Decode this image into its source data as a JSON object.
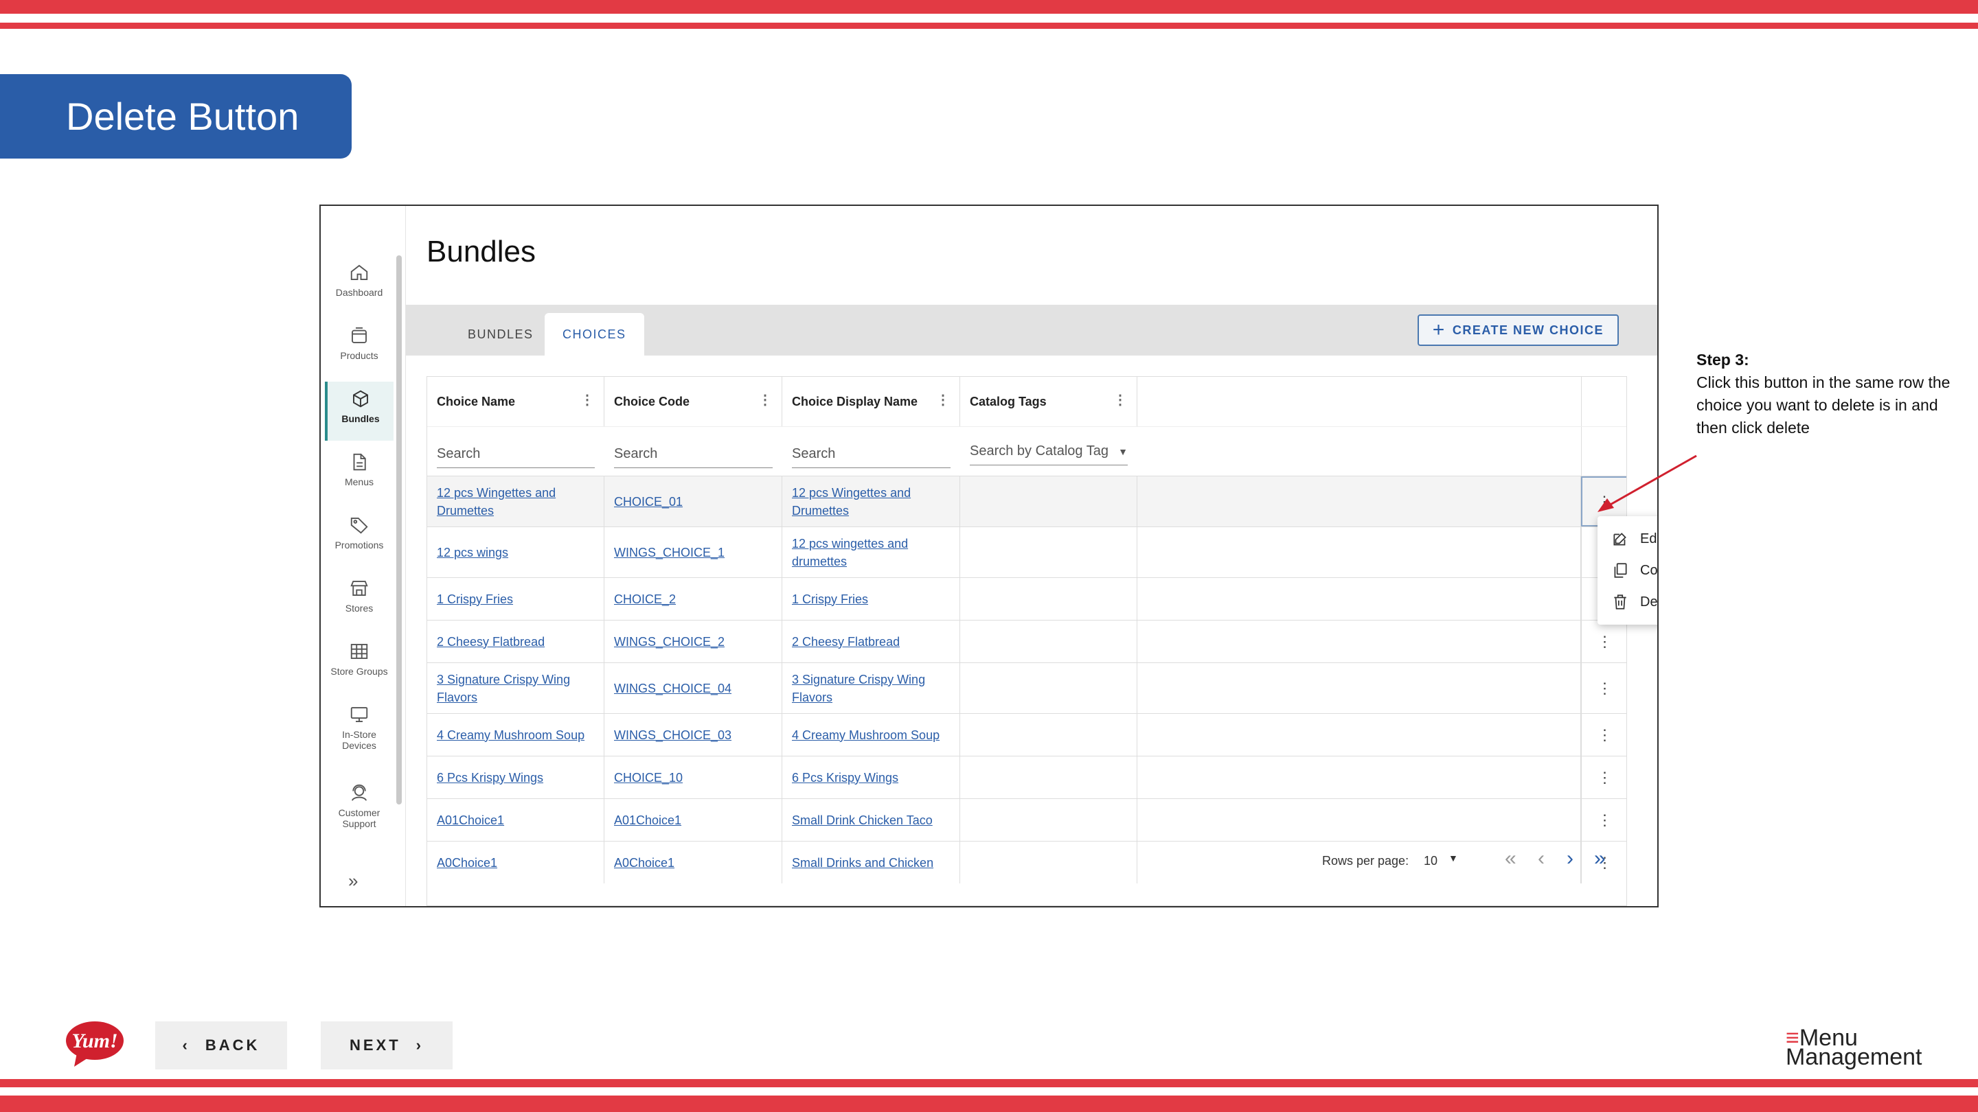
{
  "slide": {
    "title": "Delete Button",
    "annotation": {
      "heading": "Step 3:",
      "body": "Click this  button in the same row the choice you want to delete is in and then click delete"
    },
    "footer": {
      "back_label": "BACK",
      "next_label": "NEXT",
      "logo_text": "Yum!",
      "brand_line1": "Menu",
      "brand_line2": "Management"
    },
    "colors": {
      "accent_red": "#e23a44",
      "banner_blue": "#2a5da8",
      "link_blue": "#2a5da8"
    }
  },
  "app": {
    "page_title": "Bundles",
    "sidebar": {
      "items": [
        {
          "label": "Dashboard",
          "icon": "home-icon"
        },
        {
          "label": "Products",
          "icon": "box-icon"
        },
        {
          "label": "Bundles",
          "icon": "cube-icon"
        },
        {
          "label": "Menus",
          "icon": "document-icon"
        },
        {
          "label": "Promotions",
          "icon": "tag-icon"
        },
        {
          "label": "Stores",
          "icon": "store-icon"
        },
        {
          "label": "Store Groups",
          "icon": "grid-icon"
        },
        {
          "label": "In-Store Devices",
          "icon": "monitor-icon"
        },
        {
          "label": "Customer Support",
          "icon": "support-icon"
        }
      ],
      "expand_icon": "double-chevron-right-icon"
    },
    "tabs": [
      {
        "label": "BUNDLES"
      },
      {
        "label": "CHOICES"
      }
    ],
    "create_button_label": "CREATE NEW CHOICE",
    "table": {
      "columns": [
        "Choice Name",
        "Choice Code",
        "Choice Display Name",
        "Catalog Tags"
      ],
      "search_placeholders": [
        "Search",
        "Search",
        "Search",
        "Search by Catalog Tag"
      ],
      "rows": [
        {
          "name": "12 pcs Wingettes and Drumettes",
          "code": "CHOICE_01",
          "display": "12 pcs Wingettes and Drumettes"
        },
        {
          "name": "12 pcs wings",
          "code": "WINGS_CHOICE_1",
          "display": "12 pcs wingettes and drumettes"
        },
        {
          "name": "1 Crispy Fries",
          "code": "CHOICE_2",
          "display": "1 Crispy Fries"
        },
        {
          "name": "2 Cheesy Flatbread",
          "code": "WINGS_CHOICE_2",
          "display": "2 Cheesy Flatbread"
        },
        {
          "name": "3 Signature Crispy Wing Flavors",
          "code": "WINGS_CHOICE_04",
          "display": "3 Signature Crispy Wing Flavors"
        },
        {
          "name": "4 Creamy Mushroom Soup",
          "code": "WINGS_CHOICE_03",
          "display": "4 Creamy Mushroom Soup"
        },
        {
          "name": "6 Pcs Krispy Wings",
          "code": "CHOICE_10",
          "display": "6 Pcs Krispy Wings"
        },
        {
          "name": "A01Choice1",
          "code": "A01Choice1",
          "display": "Small Drink Chicken Taco"
        },
        {
          "name": "A0Choice1",
          "code": "A0Choice1",
          "display": "Small Drinks and Chicken"
        }
      ]
    },
    "row_menu": {
      "items": [
        {
          "label": "Edit",
          "icon": "edit-icon"
        },
        {
          "label": "Copy",
          "icon": "copy-icon"
        },
        {
          "label": "Delete",
          "icon": "trash-icon"
        }
      ]
    },
    "pagination": {
      "rows_per_page_label": "Rows per page:",
      "rows_per_page": "10"
    }
  }
}
